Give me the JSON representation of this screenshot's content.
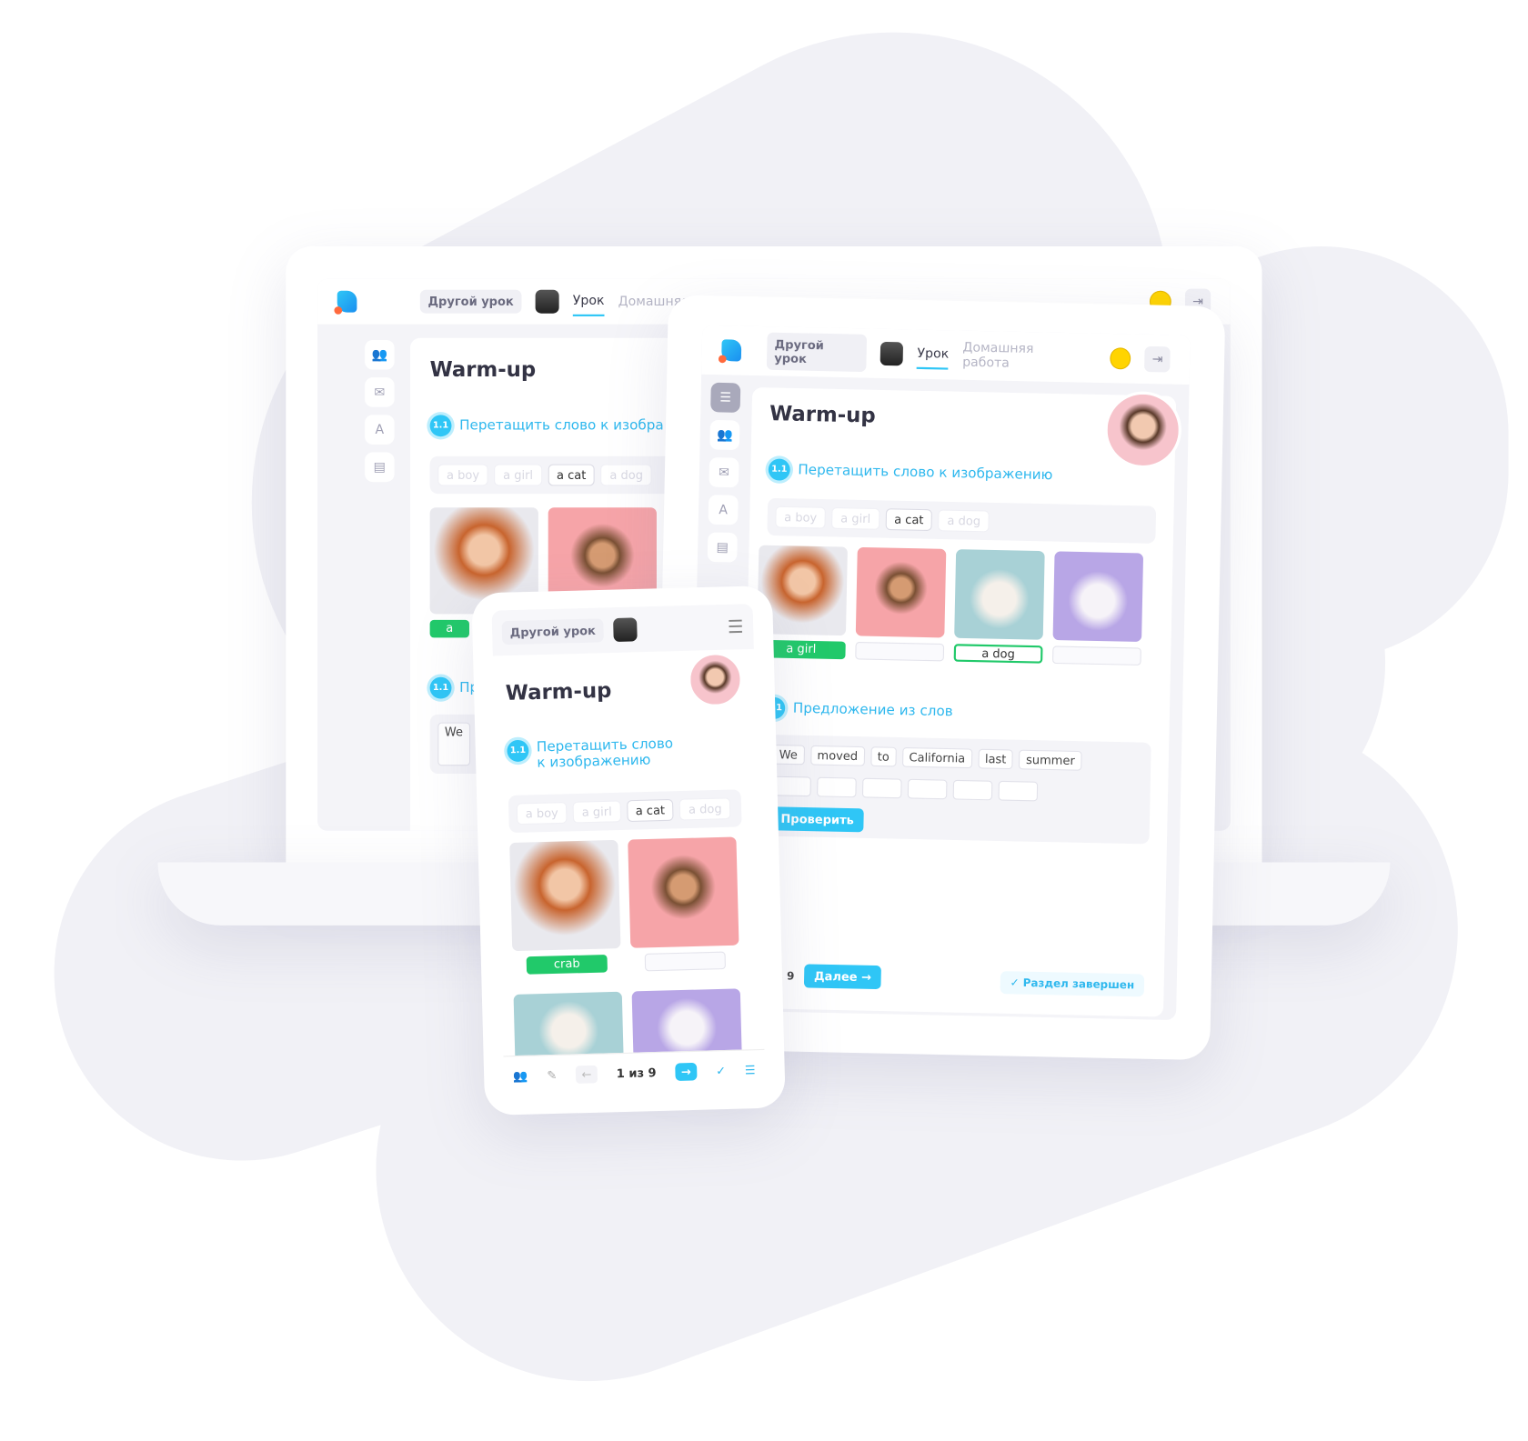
{
  "header": {
    "other_lesson": "Другой урок",
    "tab_lesson": "Урок",
    "tab_homework": "Домашняя работа",
    "homework_truncated": "Домашняя ра"
  },
  "lesson": {
    "title": "Warm-up",
    "task1": {
      "number": "1.1",
      "title": "Перетащить слово к изображению",
      "title_truncated": "Перетащить слово к изобра",
      "title_line1": "Перетащить слово",
      "title_line2": "к изображению",
      "words": [
        "a boy",
        "a girl",
        "a cat",
        "a dog"
      ],
      "answers_tablet": [
        "a girl",
        "",
        "a dog",
        ""
      ],
      "answers_phone": [
        "crab",
        ""
      ],
      "answer_laptop": "a"
    },
    "task2": {
      "number": "1.1",
      "title": "Предложение из слов",
      "title_truncated": "Пр",
      "words": [
        "We",
        "moved",
        "to",
        "California",
        "last",
        "summer"
      ],
      "check": "Проверить"
    }
  },
  "footer": {
    "pager": "1 из 9",
    "next": "Далее",
    "section_done": "Раздел завершен"
  },
  "icons": {
    "sidebar": [
      "list-icon",
      "users-icon",
      "chat-icon",
      "translate-icon",
      "clipboard-icon"
    ],
    "exit": "exit-icon"
  },
  "colors": {
    "accent": "#2fc6f6",
    "success": "#21c96a",
    "error": "#ff4d5e"
  }
}
